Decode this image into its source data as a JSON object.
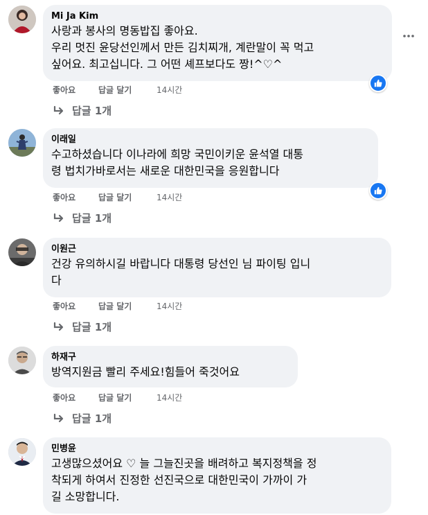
{
  "comments": [
    {
      "author": "Mi Ja Kim",
      "lines": [
        "사랑과 봉사의 명동밥집 좋아요.",
        "우리 멋진 윤당선인께서 만든 김치찌개, 계란말이 꼭 먹고",
        "싶어요. 최고십니다. 그 어떤 셰프보다도 짱!^♡^"
      ],
      "actions": {
        "like": "좋아요",
        "reply": "답글 달기",
        "time": "14시간"
      },
      "replies": "답글 1개",
      "liked": true,
      "more_icon": "more-horizontal-icon"
    },
    {
      "author": "이래일",
      "lines": [
        "수고하셨습니다 이나라에 희망 국민이키운 윤석열 대통",
        "령 법치가바로서는 새로운 대한민국을 응원합니다"
      ],
      "actions": {
        "like": "좋아요",
        "reply": "답글 달기",
        "time": "14시간"
      },
      "replies": "답글 1개",
      "liked": true
    },
    {
      "author": "이원근",
      "lines": [
        "건강 유의하시길 바랍니다 대통령 당선인 님 파이팅 입니",
        "다"
      ],
      "actions": {
        "like": "좋아요",
        "reply": "답글 달기",
        "time": "14시간"
      },
      "replies": "답글 1개",
      "liked": false
    },
    {
      "author": "하재구",
      "lines": [
        "방역지원금 빨리 주세요!힘들어 죽것어요"
      ],
      "actions": {
        "like": "좋아요",
        "reply": "답글 달기",
        "time": "14시간"
      },
      "replies": "답글 1개",
      "liked": false
    },
    {
      "author": "민병윤",
      "lines": [
        "고생많으셨어요 ♡ 늘 그늘진곳을 배려하고 복지정책을 정",
        "착되게 하여서 진정한 선진국으로 대한민국이 가까이 가",
        "길 소망합니다."
      ],
      "liked": false
    }
  ],
  "colors": {
    "bubble": "#f0f2f5",
    "secondary_text": "#65676b",
    "like_blue": "#1877f2"
  }
}
